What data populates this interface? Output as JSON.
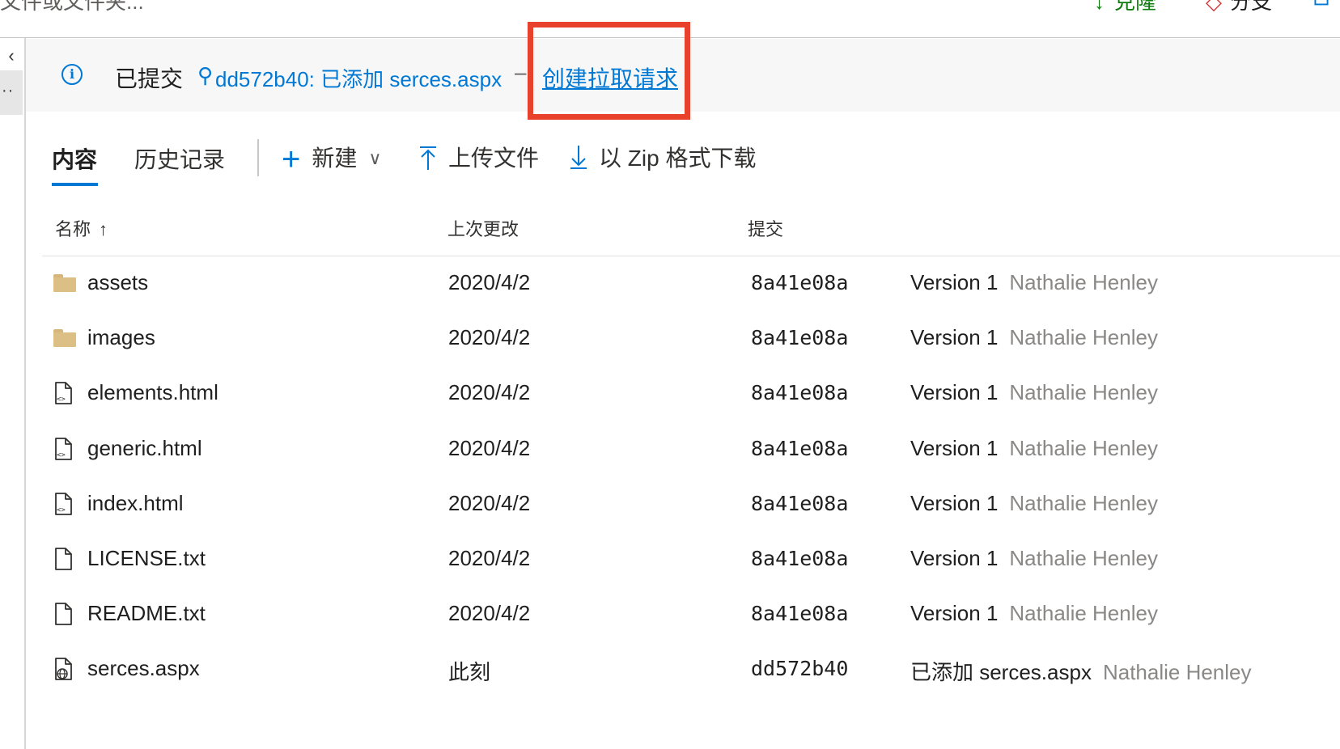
{
  "top_bar": {
    "left_text": "文件或文件夹...",
    "clone_label": "克隆",
    "branch_label": "分支",
    "more_glyph": "⊡"
  },
  "left_rail": {
    "collapse_glyph": "‹",
    "more_glyph": "··"
  },
  "banner": {
    "status": "已提交",
    "commit_text": "dd572b40: 已添加 serces.aspx",
    "separator": "–",
    "pr_link": "创建拉取请求",
    "highlight_color": "#e8412c"
  },
  "toolbar": {
    "tabs": [
      {
        "label": "内容",
        "selected": true
      },
      {
        "label": "历史记录",
        "selected": false
      }
    ],
    "new_label": "新建",
    "upload_label": "上传文件",
    "download_label": "以 Zip 格式下载"
  },
  "table": {
    "headers": {
      "name": "名称",
      "last_change": "上次更改",
      "commit": "提交"
    },
    "rows": [
      {
        "icon": "folder-icon",
        "name": "assets",
        "date": "2020/4/2",
        "hash": "8a41e08a",
        "message": "Version 1",
        "author": "Nathalie Henley"
      },
      {
        "icon": "folder-icon",
        "name": "images",
        "date": "2020/4/2",
        "hash": "8a41e08a",
        "message": "Version 1",
        "author": "Nathalie Henley"
      },
      {
        "icon": "html-file-icon",
        "name": "elements.html",
        "date": "2020/4/2",
        "hash": "8a41e08a",
        "message": "Version 1",
        "author": "Nathalie Henley"
      },
      {
        "icon": "html-file-icon",
        "name": "generic.html",
        "date": "2020/4/2",
        "hash": "8a41e08a",
        "message": "Version 1",
        "author": "Nathalie Henley"
      },
      {
        "icon": "html-file-icon",
        "name": "index.html",
        "date": "2020/4/2",
        "hash": "8a41e08a",
        "message": "Version 1",
        "author": "Nathalie Henley"
      },
      {
        "icon": "text-file-icon",
        "name": "LICENSE.txt",
        "date": "2020/4/2",
        "hash": "8a41e08a",
        "message": "Version 1",
        "author": "Nathalie Henley"
      },
      {
        "icon": "text-file-icon",
        "name": "README.txt",
        "date": "2020/4/2",
        "hash": "8a41e08a",
        "message": "Version 1",
        "author": "Nathalie Henley"
      },
      {
        "icon": "web-file-icon",
        "name": "serces.aspx",
        "date": "此刻",
        "hash": "dd572b40",
        "message": "已添加 serces.aspx",
        "author": "Nathalie Henley"
      }
    ]
  },
  "colors": {
    "accent": "#0078d4",
    "folder": "#dcbf85",
    "muted_text": "#8a8886"
  }
}
